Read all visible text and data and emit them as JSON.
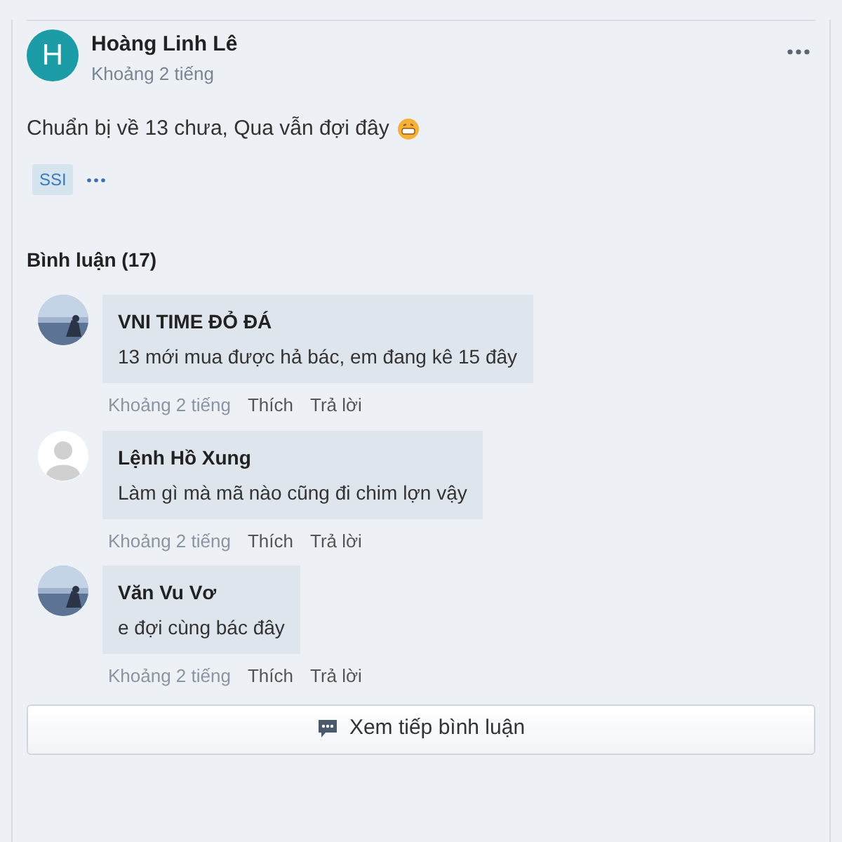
{
  "post": {
    "author": "Hoàng Linh Lê",
    "avatar_letter": "H",
    "time": "Khoảng 2 tiếng",
    "text": "Chuẩn bị về 13 chưa, Qua vẫn đợi đây",
    "tags": [
      "SSI"
    ]
  },
  "comments_header": "Bình luận (17)",
  "comments": [
    {
      "name": "VNI TIME ĐỎ ĐÁ",
      "text": "13 mới mua được hả bác, em đang kê 15 đây",
      "kind": "picture",
      "time": "Khoảng 2 tiếng",
      "like": "Thích",
      "reply": "Trả lời"
    },
    {
      "name": "Lệnh Hồ Xung",
      "text": "Làm gì mà mã nào cũng đi chim lợn vậy",
      "kind": "silhouette",
      "time": "Khoảng 2 tiếng",
      "like": "Thích",
      "reply": "Trả lời"
    },
    {
      "name": "Văn Vu Vơ",
      "text": "e đợi cùng bác đây",
      "kind": "picture",
      "time": "Khoảng 2 tiếng",
      "like": "Thích",
      "reply": "Trả lời"
    }
  ],
  "more_button": "Xem tiếp bình luận"
}
